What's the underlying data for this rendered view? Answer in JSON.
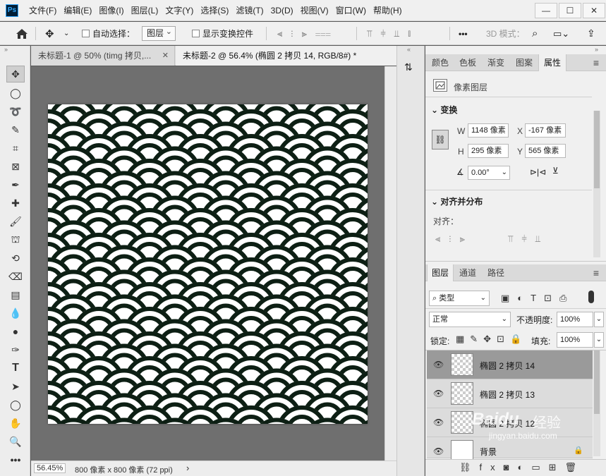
{
  "app": {
    "logo": "Ps"
  },
  "menu": [
    "文件(F)",
    "编辑(E)",
    "图像(I)",
    "图层(L)",
    "文字(Y)",
    "选择(S)",
    "滤镜(T)",
    "3D(D)",
    "视图(V)",
    "窗口(W)",
    "帮助(H)"
  ],
  "window_controls": {
    "minimize": "—",
    "maximize": "☐",
    "close": "✕"
  },
  "options": {
    "auto_select_label": "自动选择：",
    "auto_select_value": "图层",
    "show_transform_label": "显示变换控件",
    "mode_3d": "3D 模式：",
    "more": "•••"
  },
  "tabs": [
    {
      "label": "未标题-1 @ 50% (timg 拷贝,...",
      "close": "✕"
    },
    {
      "label": "未标题-2 @ 56.4% (椭圆 2 拷贝 14, RGB/8#) *",
      "close": "✕"
    }
  ],
  "status": {
    "zoom": "56.45%",
    "doc_info": "800 像素 x 800 像素 (72 ppi)",
    "arrow": "›"
  },
  "panel_tabs": [
    "颜色",
    "色板",
    "渐变",
    "图案",
    "属性"
  ],
  "properties": {
    "layer_type": "像素图层",
    "transform_header": "变换",
    "w_label": "W",
    "w_value": "1148 像素",
    "x_label": "X",
    "x_value": "-167 像素",
    "h_label": "H",
    "h_value": "295 像素",
    "y_label": "Y",
    "y_value": "565 像素",
    "angle_value": "0.00°",
    "align_header": "对齐并分布",
    "align_label": "对齐："
  },
  "layers_panel": {
    "tabs": [
      "图层",
      "通道",
      "路径"
    ],
    "filter_kind": "类型",
    "blend_mode": "正常",
    "opacity_label": "不透明度:",
    "opacity_value": "100%",
    "lock_label": "锁定:",
    "fill_label": "填充:",
    "fill_value": "100%",
    "layers": [
      {
        "name": "椭圆 2 拷贝 14",
        "selected": true
      },
      {
        "name": "椭圆 2 拷贝 13",
        "selected": false
      },
      {
        "name": "椭圆 2 拷贝 12",
        "selected": false
      },
      {
        "name": "背景",
        "selected": false
      }
    ]
  },
  "watermark": {
    "brand": "Baidu",
    "brand_cn": "经验",
    "url": "jingyan.baidu.com"
  },
  "colors": {
    "pattern_stroke": "#0d1f14",
    "selected_layer": "#9a9a9a",
    "canvas_bg": "#6f6f6f"
  }
}
